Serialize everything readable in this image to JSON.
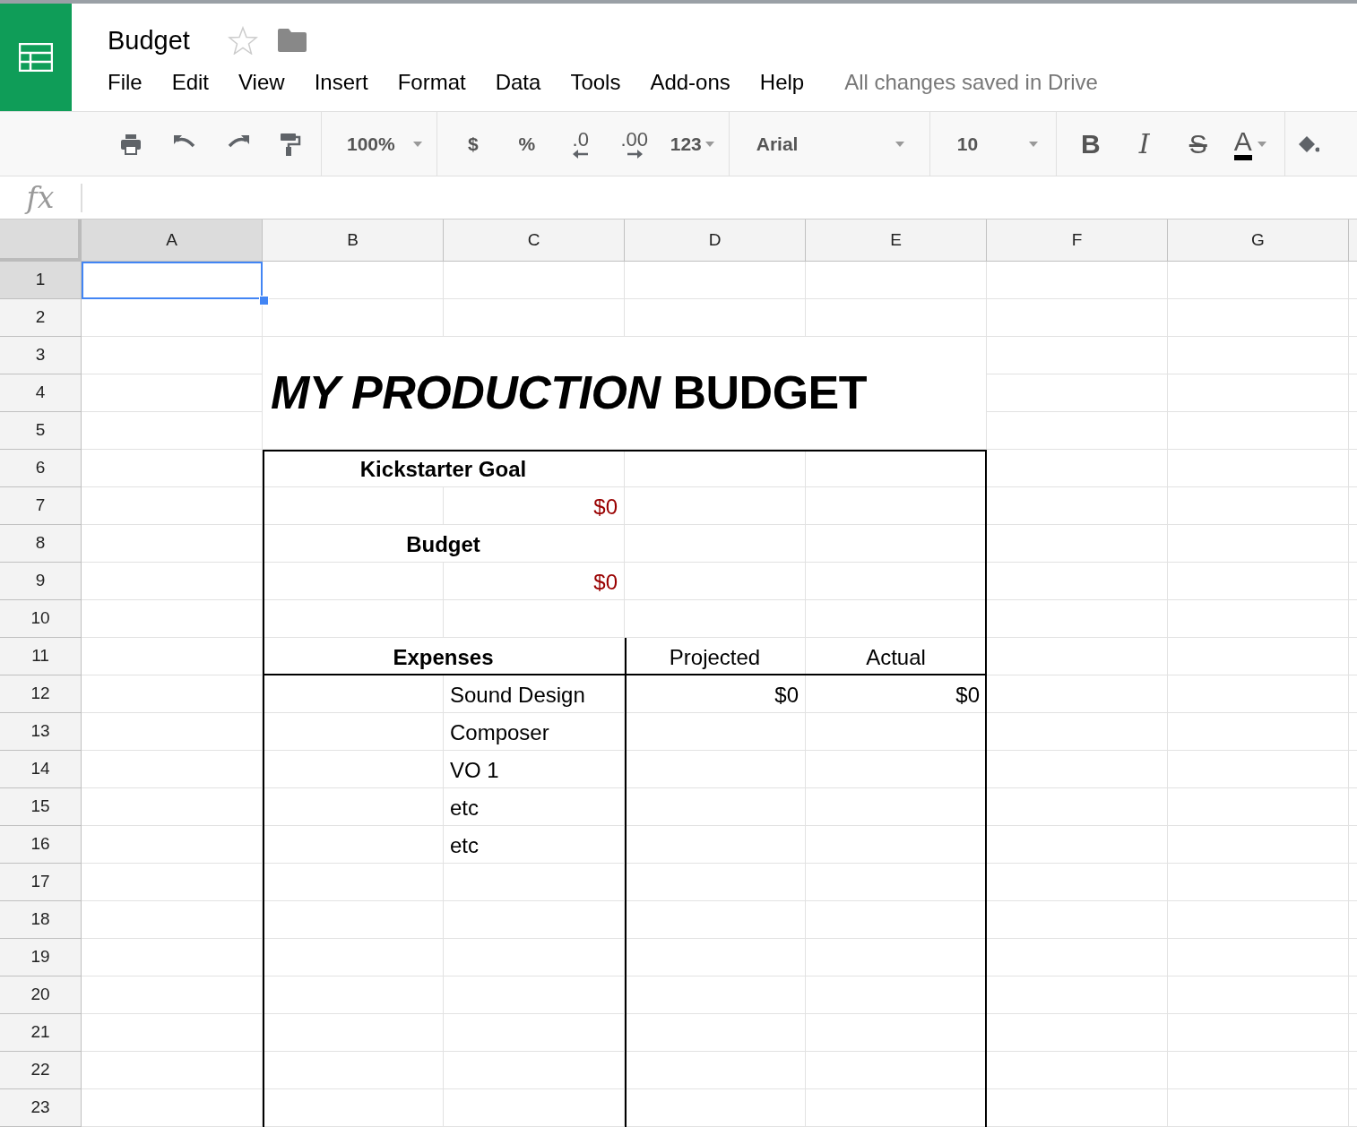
{
  "document": {
    "title": "Budget",
    "starred": false,
    "status": "All changes saved in Drive"
  },
  "menu": [
    "File",
    "Edit",
    "View",
    "Insert",
    "Format",
    "Data",
    "Tools",
    "Add-ons",
    "Help"
  ],
  "toolbar": {
    "zoom": "100%",
    "number_formats": [
      {
        "kind": "currency",
        "label": "$"
      },
      {
        "kind": "percent",
        "label": "%"
      },
      {
        "kind": "decrease-decimal",
        "label": ".0"
      },
      {
        "kind": "increase-decimal",
        "label": ".00"
      },
      {
        "kind": "more-formats",
        "label": "123"
      }
    ],
    "font": "Arial",
    "font_size": "10",
    "text_styles": [
      {
        "kind": "bold",
        "label": "B"
      },
      {
        "kind": "italic",
        "label": "I"
      },
      {
        "kind": "strikethrough",
        "label": "S"
      },
      {
        "kind": "text-color",
        "label": "A"
      }
    ]
  },
  "formula_bar": {
    "label": "fx"
  },
  "sheet": {
    "columns": [
      {
        "label": "A",
        "selected": true
      },
      {
        "label": "B",
        "selected": false
      },
      {
        "label": "C",
        "selected": false
      },
      {
        "label": "D",
        "selected": false
      },
      {
        "label": "E",
        "selected": false
      },
      {
        "label": "F",
        "selected": false
      },
      {
        "label": "G",
        "selected": false
      }
    ],
    "rows": [
      {
        "number": "1",
        "selected": true,
        "cells": []
      },
      {
        "number": "2",
        "selected": false,
        "cells": []
      },
      {
        "number": "3",
        "selected": false,
        "cells": []
      },
      {
        "number": "4",
        "selected": false,
        "cells": [
          "",
          {
            "kind": "title",
            "text": "*MY PRODUCTION* BUDGET"
          }
        ]
      },
      {
        "number": "5",
        "selected": false,
        "cells": []
      },
      {
        "number": "6",
        "selected": false,
        "cells": [
          "",
          {
            "kind": "heading",
            "text": "Kickstarter Goal"
          }
        ]
      },
      {
        "number": "7",
        "selected": false,
        "cells": [
          "",
          "",
          {
            "kind": "money",
            "text": "$0",
            "color": "#990000"
          }
        ]
      },
      {
        "number": "8",
        "selected": false,
        "cells": [
          "",
          {
            "kind": "heading",
            "text": "Budget"
          }
        ]
      },
      {
        "number": "9",
        "selected": false,
        "cells": [
          "",
          "",
          {
            "kind": "money",
            "text": "$0",
            "color": "#990000"
          }
        ]
      },
      {
        "number": "10",
        "selected": false,
        "cells": []
      },
      {
        "number": "11",
        "selected": false,
        "cells": [
          "",
          {
            "kind": "heading",
            "text": "Expenses"
          },
          "",
          {
            "kind": "column-heading",
            "text": "Projected"
          },
          {
            "kind": "column-heading",
            "text": "Actual"
          }
        ]
      },
      {
        "number": "12",
        "selected": false,
        "cells": [
          "",
          "",
          {
            "kind": "label",
            "text": "Sound Design"
          },
          {
            "kind": "money",
            "text": "$0",
            "color": "#000000"
          },
          {
            "kind": "money",
            "text": "$0",
            "color": "#000000"
          }
        ]
      },
      {
        "number": "13",
        "selected": false,
        "cells": [
          "",
          "",
          {
            "kind": "label",
            "text": "Composer"
          }
        ]
      },
      {
        "number": "14",
        "selected": false,
        "cells": [
          "",
          "",
          {
            "kind": "label",
            "text": "VO 1"
          }
        ]
      },
      {
        "number": "15",
        "selected": false,
        "cells": [
          "",
          "",
          {
            "kind": "label",
            "text": "etc"
          }
        ]
      },
      {
        "number": "16",
        "selected": false,
        "cells": [
          "",
          "",
          {
            "kind": "label",
            "text": "etc"
          }
        ]
      },
      {
        "number": "17",
        "selected": false,
        "cells": []
      },
      {
        "number": "18",
        "selected": false,
        "cells": []
      },
      {
        "number": "19",
        "selected": false,
        "cells": []
      },
      {
        "number": "20",
        "selected": false,
        "cells": []
      },
      {
        "number": "21",
        "selected": false,
        "cells": []
      },
      {
        "number": "22",
        "selected": false,
        "cells": []
      },
      {
        "number": "23",
        "selected": false,
        "cells": []
      }
    ]
  }
}
